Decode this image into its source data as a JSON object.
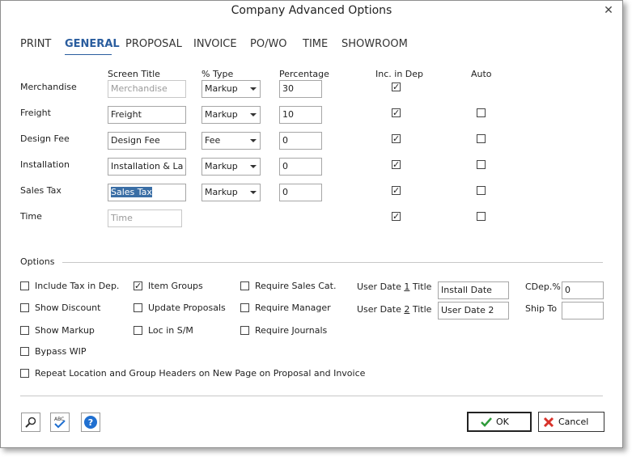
{
  "window": {
    "title": "Company Advanced Options",
    "close_glyph": "✕"
  },
  "tabs": [
    {
      "label": "PRINT"
    },
    {
      "label": "GENERAL",
      "active": true
    },
    {
      "label": "PROPOSAL"
    },
    {
      "label": "INVOICE"
    },
    {
      "label": "PO/WO"
    },
    {
      "label": "TIME"
    },
    {
      "label": "SHOWROOM"
    }
  ],
  "columns": {
    "screen_title": "Screen Title",
    "type": "% Type",
    "percentage": "Percentage",
    "inc_in_dep": "Inc. in Dep",
    "auto": "Auto"
  },
  "rows": [
    {
      "label": "Merchandise",
      "screen_title": "Merchandise",
      "type": "Markup",
      "percentage": "30",
      "inc_in_dep": true,
      "auto": null
    },
    {
      "label": "Freight",
      "screen_title": "Freight",
      "type": "Markup",
      "percentage": "10",
      "inc_in_dep": true,
      "auto": false
    },
    {
      "label": "Design Fee",
      "screen_title": "Design Fee",
      "type": "Fee",
      "percentage": "0",
      "inc_in_dep": true,
      "auto": false
    },
    {
      "label": "Installation",
      "screen_title": "Installation & La",
      "type": "Markup",
      "percentage": "0",
      "inc_in_dep": true,
      "auto": false
    },
    {
      "label": "Sales Tax",
      "screen_title": "Sales Tax",
      "type": "Markup",
      "percentage": "0",
      "inc_in_dep": true,
      "auto": false
    },
    {
      "label": "Time",
      "screen_title": "Time",
      "type": null,
      "percentage": null,
      "inc_in_dep": true,
      "auto": false
    }
  ],
  "options": {
    "section_label": "Options",
    "include_tax": {
      "label": "Include Tax in Dep.",
      "checked": false
    },
    "show_discount": {
      "label": "Show Discount",
      "checked": false
    },
    "show_markup": {
      "label": "Show Markup",
      "checked": false
    },
    "bypass_wip": {
      "label": "Bypass WIP",
      "checked": false
    },
    "item_groups": {
      "label": "Item Groups",
      "checked": true
    },
    "update_proposals": {
      "label": "Update Proposals",
      "checked": false
    },
    "loc_in_sm": {
      "label": "Loc in S/M",
      "checked": false
    },
    "require_sales_cat": {
      "label": "Require Sales Cat.",
      "checked": false
    },
    "require_manager": {
      "label": "Require Manager",
      "checked": false
    },
    "require_journals": {
      "label": "Require Journals",
      "checked": false
    },
    "repeat_headers": {
      "label": "Repeat Location and Group Headers on New Page on Proposal and Invoice",
      "checked": false
    },
    "user_date_1": {
      "label_pre": "User Date ",
      "label_num": "1",
      "label_post": " Title",
      "value": "Install Date"
    },
    "user_date_2": {
      "label_pre": "User Date ",
      "label_num": "2",
      "label_post": " Title",
      "value": "User Date 2"
    },
    "cdep": {
      "label": "CDep.%",
      "value": "0"
    },
    "ship_to": {
      "label": "Ship To",
      "value": ""
    }
  },
  "footer": {
    "ok_label": "OK",
    "cancel_label": "Cancel"
  },
  "colors": {
    "active_tab": "#2a5d9e",
    "selection": "#3a6ea5",
    "ok_check": "#2e9b3a",
    "cancel_x": "#d8322a",
    "help_blue": "#1f6fd0"
  },
  "check_glyph": "✓"
}
